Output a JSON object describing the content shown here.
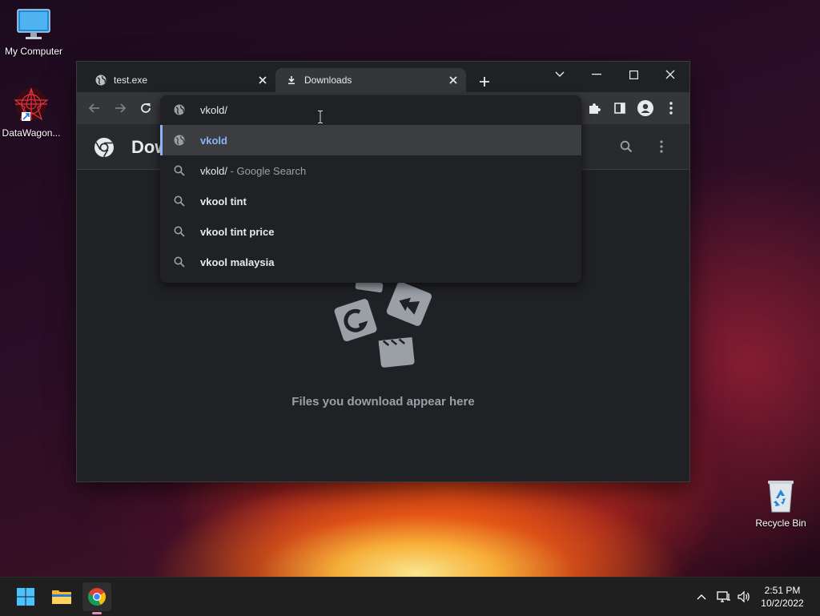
{
  "desktop": {
    "icons": [
      {
        "label": "My Computer",
        "icon": "monitor-icon"
      },
      {
        "label": "DataWagon...",
        "icon": "datawagon-shortcut-icon"
      },
      {
        "label": "Recycle Bin",
        "icon": "recycle-bin-icon"
      }
    ]
  },
  "browser": {
    "tabs": [
      {
        "title": "test.exe",
        "icon": "globe-icon",
        "active": false
      },
      {
        "title": "Downloads",
        "icon": "download-icon",
        "active": true
      }
    ],
    "page_title_partial": "Dow",
    "empty_message": "Files you download appear here"
  },
  "omnibox": {
    "input_value": "vkold/",
    "suggestions": [
      {
        "icon": "globe-icon",
        "main": "vkold",
        "suffix": "",
        "selected": true
      },
      {
        "icon": "search-icon",
        "main": "vkold/",
        "suffix": " - Google Search",
        "selected": false
      },
      {
        "icon": "search-icon",
        "main": "vkool tint",
        "suffix": "",
        "selected": false
      },
      {
        "icon": "search-icon",
        "main": "vkool tint price",
        "suffix": "",
        "selected": false
      },
      {
        "icon": "search-icon",
        "main": "vkool malaysia",
        "suffix": "",
        "selected": false
      }
    ]
  },
  "taskbar": {
    "time": "2:51 PM",
    "date": "10/2/2022"
  },
  "colors": {
    "accent": "#8ab4f8",
    "window_bg": "#202124",
    "toolbar_bg": "#35363a"
  }
}
